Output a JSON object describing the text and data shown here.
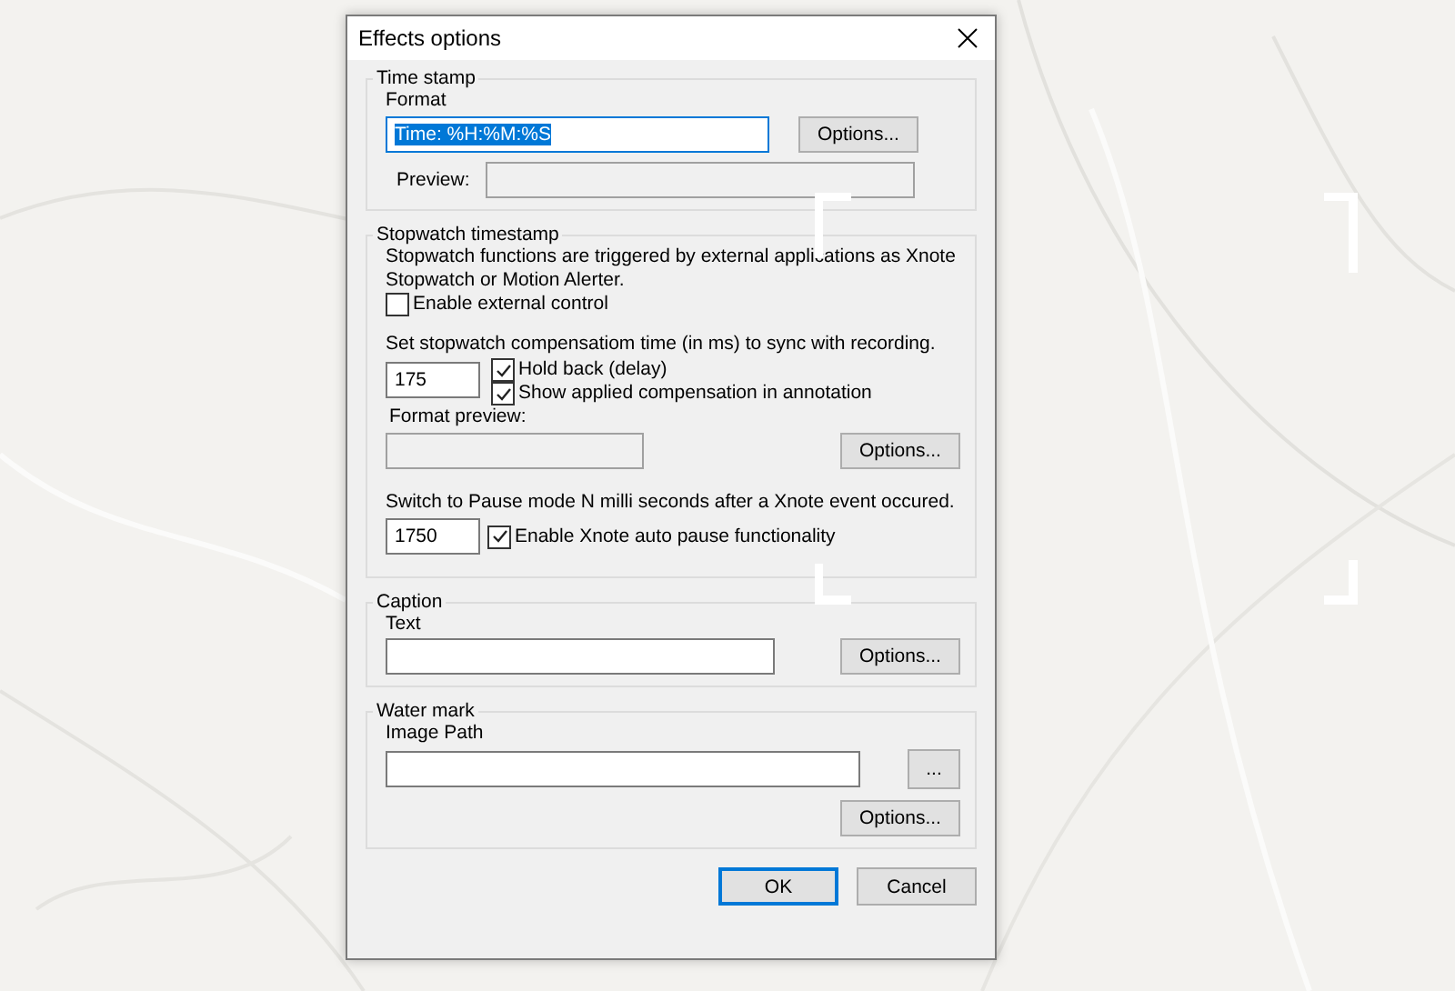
{
  "window": {
    "title": "Effects options"
  },
  "time_stamp": {
    "title": "Time stamp",
    "format_label": "Format",
    "format_value": "Time: %H:%M:%S",
    "format_value_selected": true,
    "options_button": "Options...",
    "preview_label": "Preview:",
    "preview_disabled": true
  },
  "stopwatch": {
    "title": "Stopwatch timestamp",
    "description": "Stopwatch functions are triggered by external applications as Xnote Stopwatch or Motion Alerter.",
    "external_control": {
      "label": "Enable external control",
      "checked": false
    },
    "compensation_label": "Set stopwatch compensatiom time (in ms) to sync with recording.",
    "compensation_value": "175",
    "hold_back": {
      "label": "Hold back (delay)",
      "checked": true
    },
    "show_compensation": {
      "label": "Show applied compensation in annotation",
      "checked": true
    },
    "format_preview_label": "Format preview:",
    "format_preview_disabled": true,
    "options_button": "Options...",
    "pause_label": "Switch to Pause mode N milli seconds after a Xnote event occured.",
    "pause_value": "1750",
    "auto_pause": {
      "label": "Enable Xnote auto pause functionality",
      "checked": true
    }
  },
  "caption": {
    "title": "Caption",
    "text_label": "Text",
    "options_button": "Options..."
  },
  "watermark": {
    "title": "Water mark",
    "image_path_label": "Image Path",
    "browse_button": "...",
    "options_button": "Options..."
  },
  "buttons": [
    {
      "label": "OK",
      "default": true
    },
    {
      "label": "Cancel",
      "default": false
    }
  ]
}
